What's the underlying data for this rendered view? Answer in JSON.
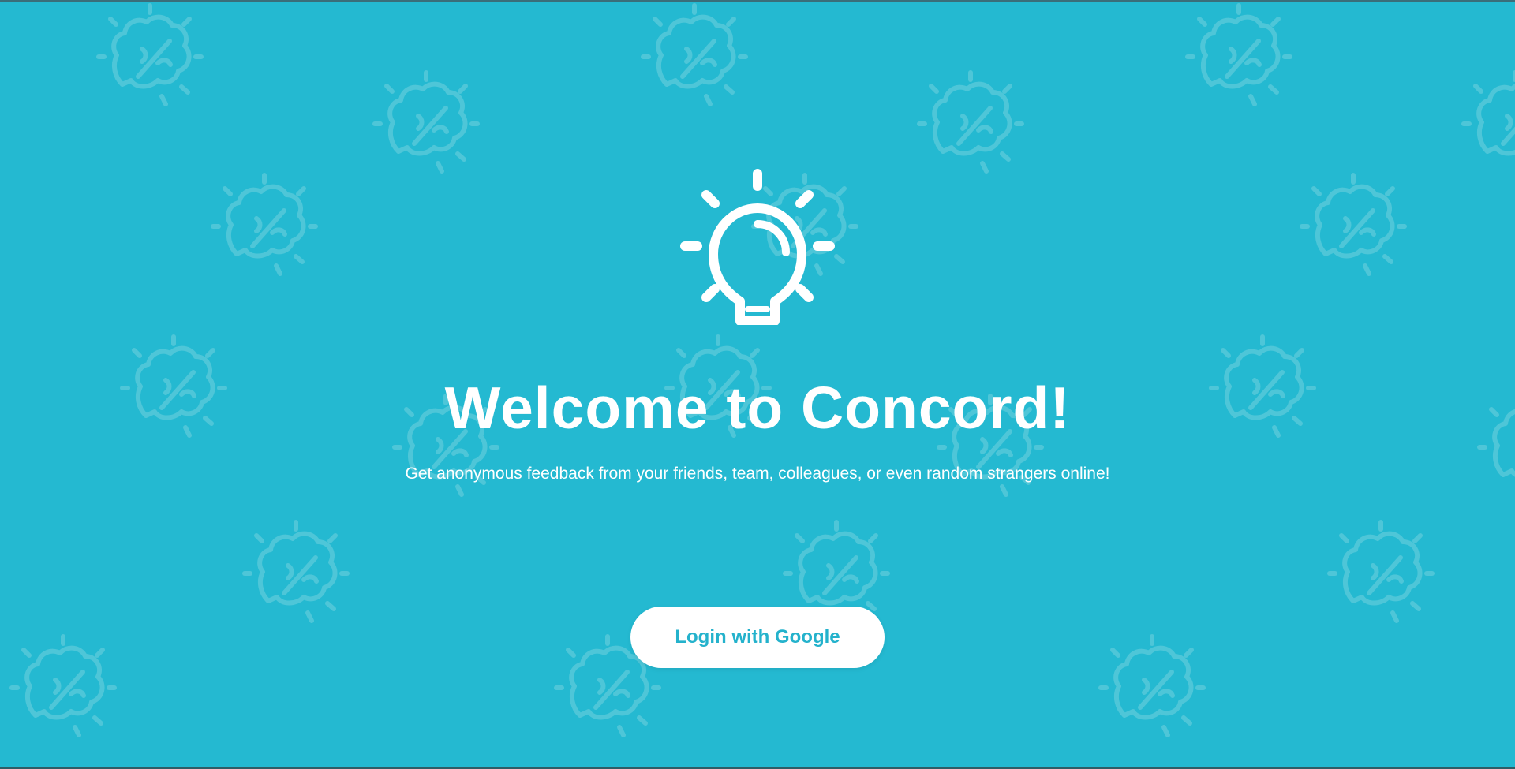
{
  "colors": {
    "background": "#24b9d1",
    "pattern": "#4ec6d8",
    "button_text": "#24b2cc",
    "foreground": "#ffffff"
  },
  "hero": {
    "icon": "lightbulb-icon",
    "title": "Welcome to Concord!",
    "subtitle": "Get anonymous feedback from your friends, team, colleagues, or even random strangers online!"
  },
  "login": {
    "label": "Login with Google"
  },
  "background_pattern": {
    "icon": "brain-lightbulb-icon"
  }
}
